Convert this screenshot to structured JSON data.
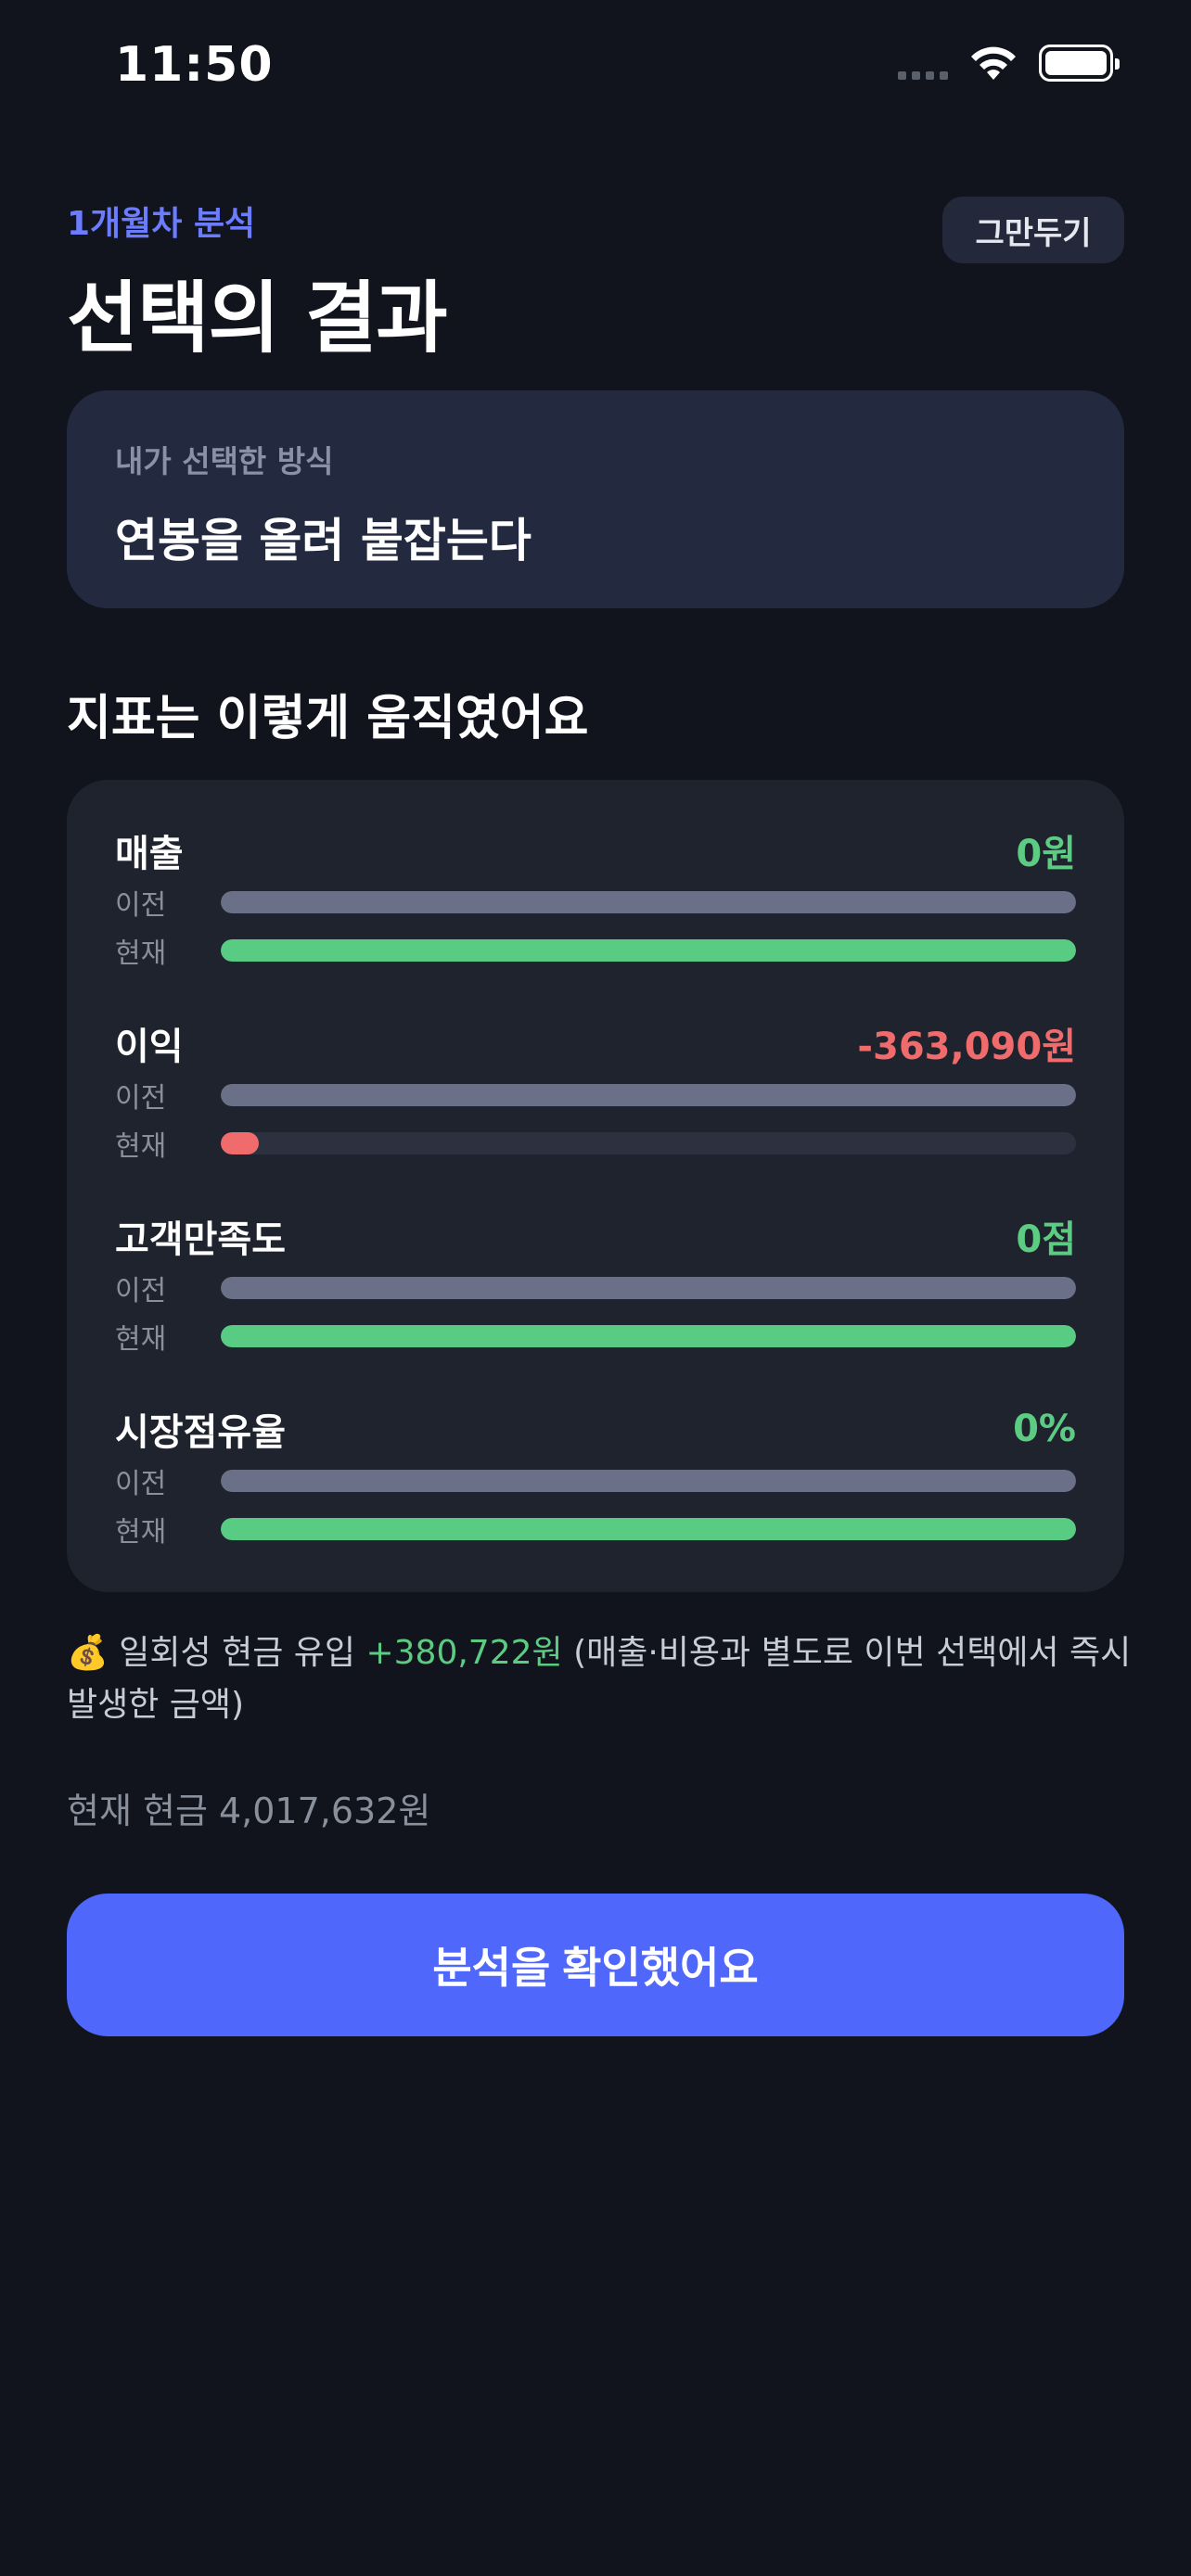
{
  "status_bar": {
    "time": "11:50",
    "icons": [
      "signal-icon",
      "wifi-icon",
      "battery-icon"
    ]
  },
  "header": {
    "eyebrow": "1개월차 분석",
    "title": "선택의 결과",
    "quit_label": "그만두기"
  },
  "choice": {
    "label": "내가 선택한 방식",
    "value": "연봉을 올려 붙잡는다"
  },
  "metrics_section": {
    "title": "지표는 이렇게 움직였어요",
    "prev_label": "이전",
    "current_label": "현재",
    "items": [
      {
        "name": "매출",
        "value": "0원",
        "prev_level": 1.0,
        "current_level": 1.0,
        "status": "positive"
      },
      {
        "name": "이익",
        "value": "-363,090원",
        "prev_level": 1.0,
        "current_level": 0.045,
        "status": "negative"
      },
      {
        "name": "고객만족도",
        "value": "0점",
        "prev_level": 1.0,
        "current_level": 1.0,
        "status": "positive"
      },
      {
        "name": "시장점유율",
        "value": "0%",
        "prev_level": 1.0,
        "current_level": 1.0,
        "status": "positive"
      }
    ]
  },
  "cash_note": {
    "emoji": "💰",
    "prefix": "일회성 현금 유입",
    "amount": "+380,722원",
    "suffix": "(매출·비용과 별도로 이번 선택에서 즉시 발생한 금액)"
  },
  "current_cash": "현재 현금 4,017,632원",
  "confirm_label": "분석을 확인했어요",
  "colors": {
    "background": "#11141c",
    "accent": "#5067fb",
    "positive": "#5ccc82",
    "negative": "#f06b6b"
  }
}
